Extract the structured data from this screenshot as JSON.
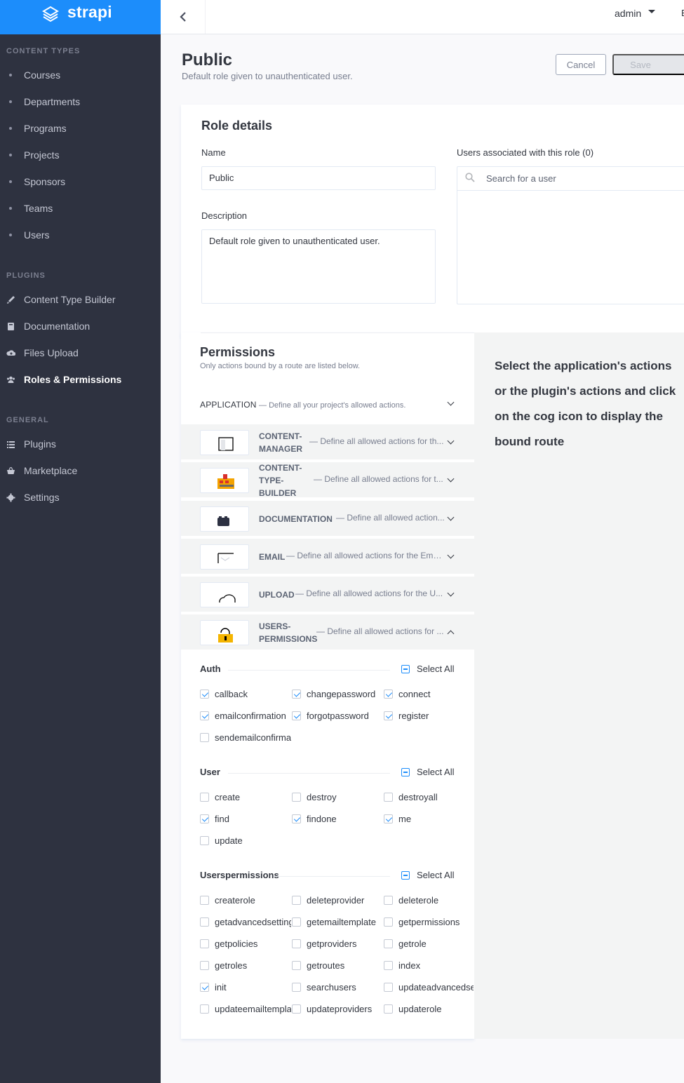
{
  "brand": {
    "name": "strapi"
  },
  "sidebar": {
    "content_types_title": "CONTENT TYPES",
    "content_types": [
      "Courses",
      "Departments",
      "Programs",
      "Projects",
      "Sponsors",
      "Teams",
      "Users"
    ],
    "plugins_title": "PLUGINS",
    "plugins": [
      {
        "label": "Content Type Builder",
        "icon": "paint-brush-icon"
      },
      {
        "label": "Documentation",
        "icon": "book-icon"
      },
      {
        "label": "Files Upload",
        "icon": "cloud-upload-icon"
      },
      {
        "label": "Roles & Permissions",
        "icon": "users-icon",
        "active": true
      }
    ],
    "general_title": "GENERAL",
    "general": [
      {
        "label": "Plugins",
        "icon": "list-icon"
      },
      {
        "label": "Marketplace",
        "icon": "shopping-basket-icon"
      },
      {
        "label": "Settings",
        "icon": "gear-icon"
      }
    ]
  },
  "header": {
    "user": "admin",
    "lang_cut": "E"
  },
  "page": {
    "title": "Public",
    "subtitle": "Default role given to unauthenticated user.",
    "cancel_label": "Cancel",
    "save_label": "Save"
  },
  "role_details": {
    "title": "Role details",
    "name_label": "Name",
    "name_value": "Public",
    "description_label": "Description",
    "description_value": "Default role given to unauthenticated user.",
    "users_label": "Users associated with this role (0)",
    "users_search_placeholder": "Search for a user"
  },
  "permissions": {
    "title": "Permissions",
    "subtitle": "Only actions bound by a route are listed below.",
    "application_name": "APPLICATION",
    "application_desc": "— Define all your project's allowed actions.",
    "hint": "Select the application's actions or the plugin's actions and click on the cog icon to display the bound route",
    "plugins": [
      {
        "name": "CONTENT-\nMANAGER",
        "desc": "— Define all allowed actions for th..."
      },
      {
        "name": "CONTENT-\nTYPE-\nBUILDER",
        "desc": "— Define all allowed actions for t..."
      },
      {
        "name": "DOCUMENTATION",
        "desc": "— Define all allowed action..."
      },
      {
        "name": "EMAIL",
        "desc": "— Define all allowed actions for the Ema..."
      },
      {
        "name": "UPLOAD",
        "desc": "— Define all allowed actions for the U..."
      },
      {
        "name": "USERS-\nPERMISSIONS",
        "desc": "— Define all allowed actions for ..."
      }
    ],
    "select_all": "Select All",
    "groups": [
      {
        "title": "Auth",
        "actions": [
          {
            "label": "callback",
            "checked": true
          },
          {
            "label": "changepassword",
            "checked": true
          },
          {
            "label": "connect",
            "checked": true
          },
          {
            "label": "emailconfirmation",
            "checked": true
          },
          {
            "label": "forgotpassword",
            "checked": true
          },
          {
            "label": "register",
            "checked": true
          },
          {
            "label": "sendemailconfirmation",
            "checked": false
          }
        ]
      },
      {
        "title": "User",
        "actions": [
          {
            "label": "create",
            "checked": false
          },
          {
            "label": "destroy",
            "checked": false
          },
          {
            "label": "destroyall",
            "checked": false
          },
          {
            "label": "find",
            "checked": true
          },
          {
            "label": "findone",
            "checked": true
          },
          {
            "label": "me",
            "checked": true
          },
          {
            "label": "update",
            "checked": false
          }
        ]
      },
      {
        "title": "Userspermissions",
        "actions": [
          {
            "label": "createrole",
            "checked": false
          },
          {
            "label": "deleteprovider",
            "checked": false
          },
          {
            "label": "deleterole",
            "checked": false
          },
          {
            "label": "getadvancedsettings",
            "checked": false
          },
          {
            "label": "getemailtemplate",
            "checked": false
          },
          {
            "label": "getpermissions",
            "checked": false
          },
          {
            "label": "getpolicies",
            "checked": false
          },
          {
            "label": "getproviders",
            "checked": false
          },
          {
            "label": "getrole",
            "checked": false
          },
          {
            "label": "getroles",
            "checked": false
          },
          {
            "label": "getroutes",
            "checked": false
          },
          {
            "label": "index",
            "checked": false
          },
          {
            "label": "init",
            "checked": true
          },
          {
            "label": "searchusers",
            "checked": false
          },
          {
            "label": "updateadvancedsettings",
            "checked": false
          },
          {
            "label": "updateemailtemplate",
            "checked": false
          },
          {
            "label": "updateproviders",
            "checked": false
          },
          {
            "label": "updaterole",
            "checked": false
          }
        ]
      }
    ]
  },
  "colors": {
    "accent": "#1c8dfb",
    "sidebar": "#2e3240"
  }
}
